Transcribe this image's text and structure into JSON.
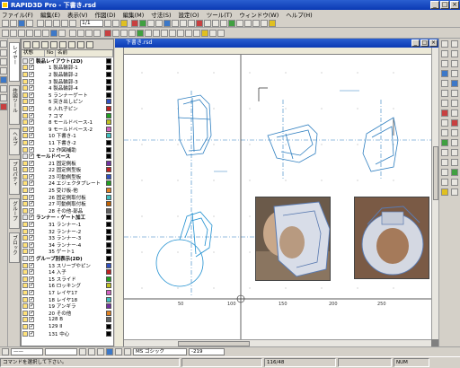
{
  "app": {
    "title": "RAPID3D Pro - 下書き.rsd",
    "controls": [
      "_",
      "□",
      "×"
    ]
  },
  "menu": [
    "ファイル(F)",
    "編集(E)",
    "表示(V)",
    "作図(D)",
    "編集(M)",
    "寸法(S)",
    "設定(O)",
    "ツール(T)",
    "ウィンドウ(W)",
    "ヘルプ(H)"
  ],
  "toolbar": {
    "zoom_value": "1/1"
  },
  "document": {
    "title": "下書き.rsd",
    "controls": [
      "_",
      "□",
      "×"
    ]
  },
  "layer_panel": {
    "columns": [
      "状態",
      "No",
      "名前"
    ],
    "rows": [
      {
        "kind": "group",
        "label": "製品レイアウト(2D)",
        "color": "#000000"
      },
      {
        "kind": "item",
        "label": "1  製品輪郭-1",
        "color": "#000000"
      },
      {
        "kind": "item",
        "label": "2  製品輪郭-2",
        "color": "#000000"
      },
      {
        "kind": "item",
        "label": "3  製品輪郭-3",
        "color": "#000000"
      },
      {
        "kind": "item",
        "label": "4  製品輪郭-4",
        "color": "#000000"
      },
      {
        "kind": "item",
        "label": "5  ランナーゲート",
        "color": "#000000"
      },
      {
        "kind": "item",
        "label": "5  突き出しピン",
        "color": "#3050c0"
      },
      {
        "kind": "item",
        "label": "6  入れ子ピン",
        "color": "#c02020"
      },
      {
        "kind": "item",
        "label": "7  コマ",
        "color": "#20a020"
      },
      {
        "kind": "item",
        "label": "8  モールドベース-1",
        "color": "#c0c020"
      },
      {
        "kind": "item",
        "label": "9  モールドベース-2",
        "color": "#d060c0"
      },
      {
        "kind": "item",
        "label": "10 下書き-1",
        "color": "#40c0c0"
      },
      {
        "kind": "item",
        "label": "11 下書き-2",
        "color": "#000000"
      },
      {
        "kind": "item",
        "label": "12 作図補助",
        "color": "#000000"
      },
      {
        "kind": "group",
        "label": "モールドベース",
        "color": "#000000"
      },
      {
        "kind": "item",
        "label": "21 固定側板",
        "color": "#7030a0"
      },
      {
        "kind": "item",
        "label": "22 固定側型板",
        "color": "#c02020"
      },
      {
        "kind": "item",
        "label": "23 可動側型板",
        "color": "#3050c0"
      },
      {
        "kind": "item",
        "label": "24 エジェクタプレート",
        "color": "#20a020"
      },
      {
        "kind": "item",
        "label": "25 受け板-他",
        "color": "#e08020"
      },
      {
        "kind": "item",
        "label": "26 固定側取付板",
        "color": "#40c0c0"
      },
      {
        "kind": "item",
        "label": "27 可動側取付板",
        "color": "#c06000"
      },
      {
        "kind": "item",
        "label": "28 その他-部品",
        "color": "#606060"
      },
      {
        "kind": "group",
        "label": "ランナー・ゲート加工",
        "color": "#000000"
      },
      {
        "kind": "item",
        "label": "31 ランナー-1",
        "color": "#000000"
      },
      {
        "kind": "item",
        "label": "32 ランナー-2",
        "color": "#000000"
      },
      {
        "kind": "item",
        "label": "33 ランナー-3",
        "color": "#000000"
      },
      {
        "kind": "item",
        "label": "34 ランナー-4",
        "color": "#000000"
      },
      {
        "kind": "item",
        "label": "35 ゲート1",
        "color": "#000000"
      },
      {
        "kind": "group",
        "label": "グループ別表示(2D)",
        "color": "#000000"
      },
      {
        "kind": "item",
        "label": "13 スリーブやピン",
        "color": "#3050c0"
      },
      {
        "kind": "item",
        "label": "14 入子",
        "color": "#c02020"
      },
      {
        "kind": "item",
        "label": "15 スライド",
        "color": "#20a020"
      },
      {
        "kind": "item",
        "label": "16 ロッキング",
        "color": "#c0c020"
      },
      {
        "kind": "item",
        "label": "17 レイヤ17",
        "color": "#d060c0"
      },
      {
        "kind": "item",
        "label": "18 レイヤ18",
        "color": "#40c0c0"
      },
      {
        "kind": "item",
        "label": "19 アンギラ",
        "color": "#7030a0"
      },
      {
        "kind": "item",
        "label": "20 その他",
        "color": "#e08020"
      },
      {
        "kind": "item",
        "label": "128 B",
        "color": "#606060"
      },
      {
        "kind": "item",
        "label": "129 II",
        "color": "#000000"
      },
      {
        "kind": "item",
        "label": "131 中心",
        "color": "#000000"
      }
    ]
  },
  "side_tabs": [
    "レイヤー",
    "作図ツール",
    "ヘルプ",
    "プロパティ",
    "グループ",
    "ブロック"
  ],
  "ruler_labels": [
    "50",
    "100",
    "150",
    "200",
    "250"
  ],
  "bottom_bar": {
    "line_type": "——",
    "font_name": "MS ゴシック",
    "coord": "-219"
  },
  "status": {
    "message": "コマンドを選択して下さい。",
    "pos": "116/48",
    "mode": "NUM"
  },
  "colors": {
    "line_blue": "#2f7fc0",
    "ring_cyan": "#1f8fd0",
    "window_blue": "#0b3ab4"
  }
}
